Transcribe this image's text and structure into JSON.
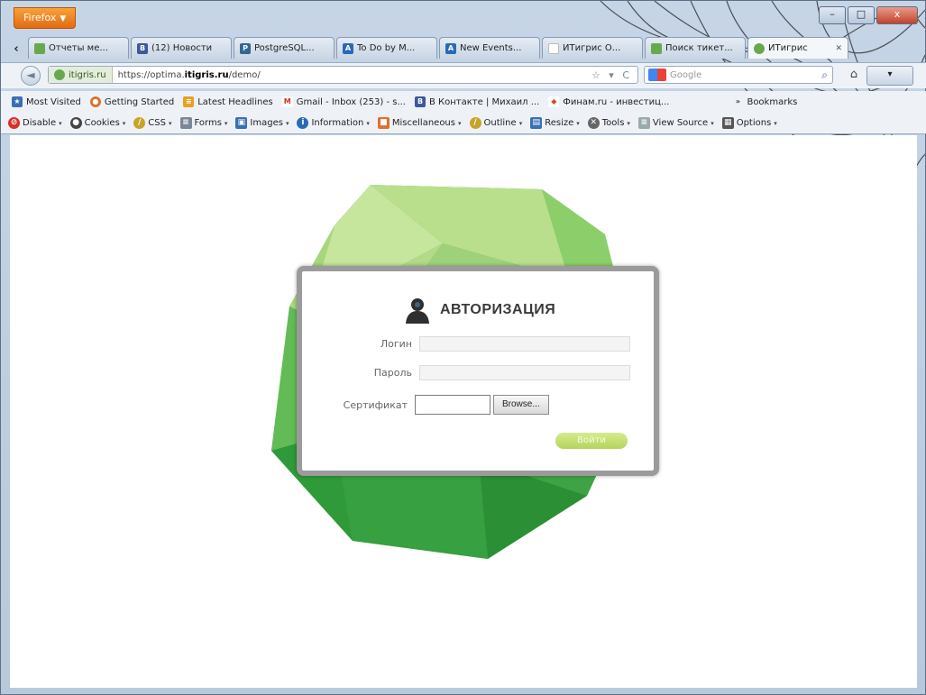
{
  "browser": {
    "app_button": "Firefox",
    "window_controls": [
      "–",
      "□",
      "x"
    ]
  },
  "tabs": [
    {
      "label": "Отчеты ме...",
      "icon_color": "#6aa84f",
      "icon": "green-leaf-icon"
    },
    {
      "label": "(12) Новости",
      "icon_color": "#3b5998",
      "icon": "vk-icon",
      "icon_text": "B"
    },
    {
      "label": "PostgreSQL...",
      "icon_color": "#336791",
      "icon": "postgres-elephant-icon",
      "icon_text": "P"
    },
    {
      "label": "To Do by M...",
      "icon_color": "#2a6ab5",
      "icon": "blue-a-icon",
      "icon_text": "A"
    },
    {
      "label": "New Events...",
      "icon_color": "#2a6ab5",
      "icon": "blue-a-icon",
      "icon_text": "A"
    },
    {
      "label": "ИТигрис О...",
      "icon_color": "#cfcfcf",
      "icon": "blank-page-icon",
      "icon_text": ""
    },
    {
      "label": "Поиск тикет...",
      "icon_color": "#6aa84f",
      "icon": "green-leaf-icon"
    },
    {
      "label": "ИТигрис",
      "icon_color": "#6aa84f",
      "icon": "green-leaf-icon",
      "active": true
    }
  ],
  "navbar": {
    "back": "◄",
    "site_identity": "itigris.ru",
    "url_prefix": "https://optima.",
    "url_host": "itigris.ru",
    "url_path": "/demo/",
    "url_icons": "☆ ▾ C",
    "search_placeholder": "Google",
    "search_go": "⌕",
    "home": "⌂"
  },
  "bookmarks": [
    {
      "label": "Most Visited",
      "icon_color": "#3a6fb5",
      "icon_text": "★"
    },
    {
      "label": "Getting Started",
      "icon_color": "#e0702a",
      "icon_text": "●"
    },
    {
      "label": "Latest Headlines",
      "icon_color": "#e8a020",
      "icon_text": "≡"
    },
    {
      "label": "Gmail - Inbox (253) - s...",
      "icon_color": "#d93025",
      "icon_text": "M"
    },
    {
      "label": "В Контакте | Михаил ...",
      "icon_color": "#3b5998",
      "icon_text": "B"
    },
    {
      "label": "Финам.ru - инвестиц...",
      "icon_color": "#d94a1a",
      "icon_text": "◆"
    },
    {
      "label": "Bookmarks",
      "icon_color": "#7a8797",
      "icon_text": "»"
    }
  ],
  "devbar": [
    {
      "label": "Disable",
      "icon_color": "#d93025",
      "icon_text": "⊘"
    },
    {
      "label": "Cookies",
      "icon_color": "#444",
      "icon_text": "●"
    },
    {
      "label": "CSS",
      "icon_color": "#c9a227",
      "icon_text": "/"
    },
    {
      "label": "Forms",
      "icon_color": "#7a8797",
      "icon_text": "≡"
    },
    {
      "label": "Images",
      "icon_color": "#3a6fb5",
      "icon_text": "▣"
    },
    {
      "label": "Information",
      "icon_color": "#2a6ab5",
      "icon_text": "i"
    },
    {
      "label": "Miscellaneous",
      "icon_color": "#e0702a",
      "icon_text": "■"
    },
    {
      "label": "Outline",
      "icon_color": "#c9a227",
      "icon_text": "/"
    },
    {
      "label": "Resize",
      "icon_color": "#3a6fb5",
      "icon_text": "▤"
    },
    {
      "label": "Tools",
      "icon_color": "#666",
      "icon_text": "✕"
    },
    {
      "label": "View Source",
      "icon_color": "#9aa",
      "icon_text": "≡"
    },
    {
      "label": "Options",
      "icon_color": "#555",
      "icon_text": "▦"
    }
  ],
  "login": {
    "title": "АВТОРИЗАЦИЯ",
    "login_label": "Логин",
    "password_label": "Пароль",
    "certificate_label": "Сертификат",
    "browse_label": "Browse...",
    "submit_label": "Войти"
  }
}
